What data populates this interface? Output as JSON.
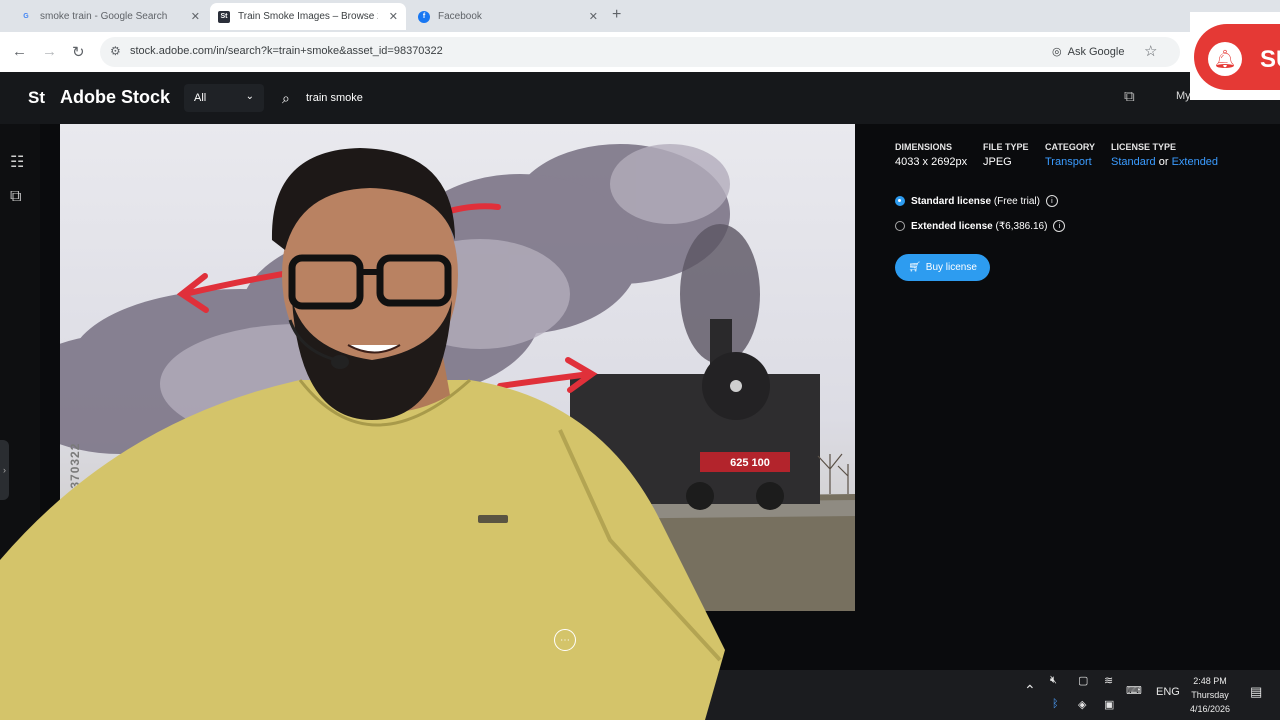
{
  "browser": {
    "tabs": [
      {
        "title": "smoke train - Google Search",
        "favicon": "G"
      },
      {
        "title": "Train Smoke Images – Browse 2",
        "favicon": "St"
      },
      {
        "title": "Facebook",
        "favicon": "f"
      }
    ],
    "url": "stock.adobe.com/in/search?k=train+smoke&asset_id=98370322",
    "ask_google": "Ask Google"
  },
  "stock": {
    "logo_mark": "St",
    "logo_text": "Adobe Stock",
    "filter_value": "All",
    "search_query": "train smoke",
    "my_libraries": "My"
  },
  "image": {
    "asset_id": "98370322",
    "locomotive_number": "625 100"
  },
  "details": {
    "dimensions_label": "DIMENSIONS",
    "dimensions": "4033 x 2692px",
    "filetype_label": "FILE TYPE",
    "filetype": "JPEG",
    "category_label": "CATEGORY",
    "category": "Transport",
    "license_label": "LICENSE TYPE",
    "license_standard": "Standard",
    "license_or": "or",
    "license_extended": "Extended"
  },
  "licenses": {
    "standard_name": "Standard license",
    "standard_note": "(Free trial)",
    "extended_name": "Extended license",
    "extended_note": "(₹6,386.16)",
    "buy_button": "Buy license"
  },
  "overlay": {
    "subscribe_text": "SU"
  },
  "taskbar": {
    "language": "ENG",
    "time": "2:48 PM",
    "day": "Thursday",
    "date": "4/16/2026"
  },
  "colors": {
    "accent": "#2d9cf0",
    "link": "#3b9cff",
    "stock_bg": "#16181b",
    "arrow_red": "#e0303a",
    "subscribe_red": "#e53935"
  }
}
